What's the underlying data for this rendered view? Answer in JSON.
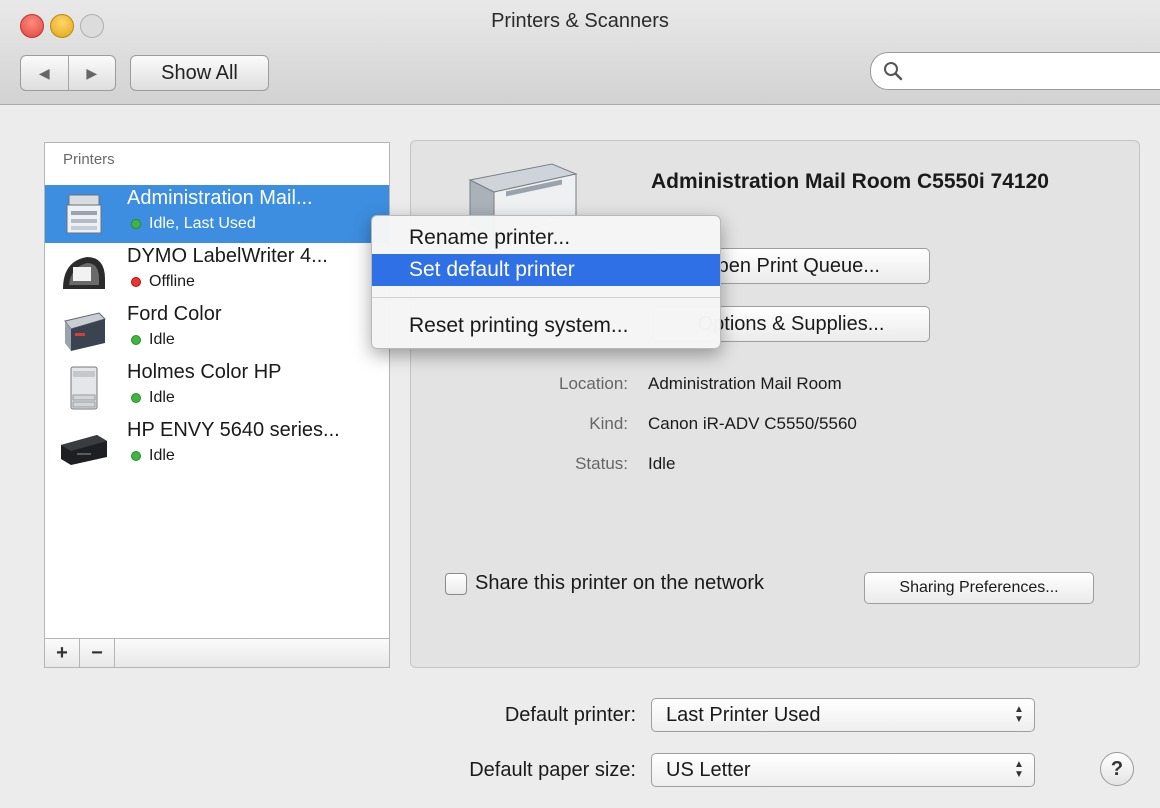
{
  "window": {
    "title": "Printers & Scanners"
  },
  "toolbar": {
    "back_glyph": "◀",
    "forward_glyph": "▶",
    "show_all_label": "Show All",
    "search_placeholder": ""
  },
  "printers": {
    "header": "Printers",
    "items": [
      {
        "name": "Administration Mail...",
        "status": "Idle, Last Used",
        "status_color": "green",
        "icon": "multifunction-printer-icon",
        "selected": true
      },
      {
        "name": "DYMO LabelWriter 4...",
        "status": "Offline",
        "status_color": "red",
        "icon": "label-printer-icon",
        "selected": false
      },
      {
        "name": "Ford Color",
        "status": "Idle",
        "status_color": "green",
        "icon": "laser-printer-icon",
        "selected": false
      },
      {
        "name": "Holmes Color HP",
        "status": "Idle",
        "status_color": "green",
        "icon": "tower-printer-icon",
        "selected": false
      },
      {
        "name": "HP ENVY 5640 series...",
        "status": "Idle",
        "status_color": "green",
        "icon": "inkjet-printer-icon",
        "selected": false
      }
    ],
    "add_label": "+",
    "remove_label": "−"
  },
  "detail": {
    "title": "Administration Mail Room C5550i 74120",
    "open_queue_label": "Open Print Queue...",
    "options_label": "Options & Supplies...",
    "info": [
      {
        "label": "Location:",
        "value": "Administration Mail Room"
      },
      {
        "label": "Kind:",
        "value": "Canon iR-ADV C5550/5560"
      },
      {
        "label": "Status:",
        "value": "Idle"
      }
    ],
    "share_label": "Share this printer on the network",
    "share_checked": false,
    "sharing_prefs_label": "Sharing Preferences..."
  },
  "context_menu": {
    "items": [
      {
        "label": "Rename printer...",
        "highlighted": false
      },
      {
        "label": "Set default printer",
        "highlighted": true
      },
      {
        "label": "Reset printing system...",
        "highlighted": false
      }
    ]
  },
  "bottom": {
    "default_printer_label": "Default printer:",
    "default_printer_value": "Last Printer Used",
    "paper_size_label": "Default paper size:",
    "paper_size_value": "US Letter",
    "help_glyph": "?"
  },
  "colors": {
    "selection": "#3d8ee0",
    "menu_highlight": "#2f70e6",
    "status_green": "#3fb63f",
    "status_red": "#e33333"
  }
}
